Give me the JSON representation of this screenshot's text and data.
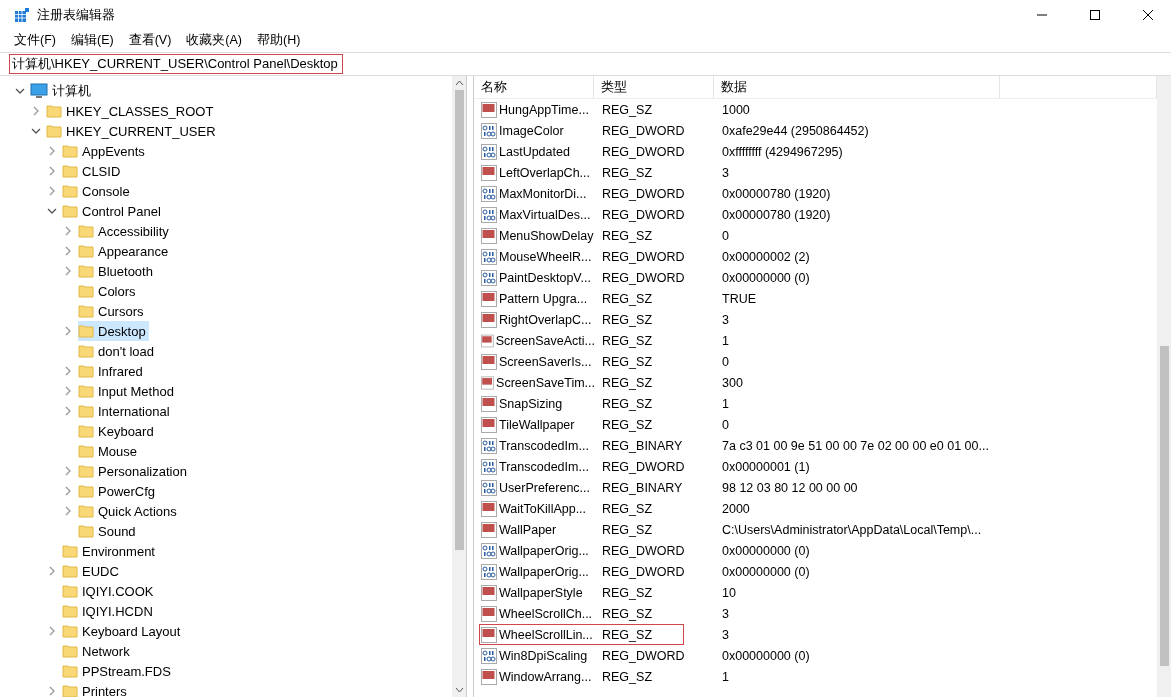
{
  "window": {
    "title": "注册表编辑器"
  },
  "menu": [
    "文件(F)",
    "编辑(E)",
    "查看(V)",
    "收藏夹(A)",
    "帮助(H)"
  ],
  "address": {
    "value": "计算机\\HKEY_CURRENT_USER\\Control Panel\\Desktop",
    "highlighted": true
  },
  "tree": [
    {
      "label": "计算机",
      "kind": "computer",
      "expanded": true,
      "selected": false,
      "children": [
        {
          "label": "HKEY_CLASSES_ROOT",
          "kind": "branch",
          "expanded": false,
          "selected": false
        },
        {
          "label": "HKEY_CURRENT_USER",
          "kind": "branch",
          "expanded": true,
          "selected": false,
          "children": [
            {
              "label": "AppEvents",
              "kind": "branch",
              "expanded": false,
              "selected": false
            },
            {
              "label": "CLSID",
              "kind": "branch",
              "expanded": false,
              "selected": false
            },
            {
              "label": "Console",
              "kind": "branch",
              "expanded": false,
              "selected": false
            },
            {
              "label": "Control Panel",
              "kind": "branch",
              "expanded": true,
              "selected": false,
              "children": [
                {
                  "label": "Accessibility",
                  "kind": "branch",
                  "expanded": false,
                  "selected": false
                },
                {
                  "label": "Appearance",
                  "kind": "branch",
                  "expanded": false,
                  "selected": false
                },
                {
                  "label": "Bluetooth",
                  "kind": "branch",
                  "expanded": false,
                  "selected": false
                },
                {
                  "label": "Colors",
                  "kind": "leaf",
                  "selected": false
                },
                {
                  "label": "Cursors",
                  "kind": "leaf",
                  "selected": false
                },
                {
                  "label": "Desktop",
                  "kind": "branch",
                  "expanded": false,
                  "selected": true
                },
                {
                  "label": "don't load",
                  "kind": "leaf",
                  "selected": false
                },
                {
                  "label": "Infrared",
                  "kind": "branch",
                  "expanded": false,
                  "selected": false
                },
                {
                  "label": "Input Method",
                  "kind": "branch",
                  "expanded": false,
                  "selected": false
                },
                {
                  "label": "International",
                  "kind": "branch",
                  "expanded": false,
                  "selected": false
                },
                {
                  "label": "Keyboard",
                  "kind": "leaf",
                  "selected": false
                },
                {
                  "label": "Mouse",
                  "kind": "leaf",
                  "selected": false
                },
                {
                  "label": "Personalization",
                  "kind": "branch",
                  "expanded": false,
                  "selected": false
                },
                {
                  "label": "PowerCfg",
                  "kind": "branch",
                  "expanded": false,
                  "selected": false
                },
                {
                  "label": "Quick Actions",
                  "kind": "branch",
                  "expanded": false,
                  "selected": false
                },
                {
                  "label": "Sound",
                  "kind": "leaf",
                  "selected": false
                }
              ]
            },
            {
              "label": "Environment",
              "kind": "leaf",
              "selected": false
            },
            {
              "label": "EUDC",
              "kind": "branch",
              "expanded": false,
              "selected": false
            },
            {
              "label": "IQIYI.COOK",
              "kind": "leaf",
              "selected": false
            },
            {
              "label": "IQIYI.HCDN",
              "kind": "leaf",
              "selected": false
            },
            {
              "label": "Keyboard Layout",
              "kind": "branch",
              "expanded": false,
              "selected": false
            },
            {
              "label": "Network",
              "kind": "leaf",
              "selected": false
            },
            {
              "label": "PPStream.FDS",
              "kind": "leaf",
              "selected": false
            },
            {
              "label": "Printers",
              "kind": "branch",
              "expanded": false,
              "selected": false
            }
          ]
        }
      ]
    }
  ],
  "table": {
    "columns": [
      "名称",
      "类型",
      "数据"
    ],
    "rows": [
      {
        "name": "HungAppTime...",
        "type": "REG_SZ",
        "data": "1000",
        "kind": "string",
        "highlighted": false
      },
      {
        "name": "ImageColor",
        "type": "REG_DWORD",
        "data": "0xafe29e44 (2950864452)",
        "kind": "binary",
        "highlighted": false
      },
      {
        "name": "LastUpdated",
        "type": "REG_DWORD",
        "data": "0xffffffff (4294967295)",
        "kind": "binary",
        "highlighted": false
      },
      {
        "name": "LeftOverlapCh...",
        "type": "REG_SZ",
        "data": "3",
        "kind": "string",
        "highlighted": false
      },
      {
        "name": "MaxMonitorDi...",
        "type": "REG_DWORD",
        "data": "0x00000780 (1920)",
        "kind": "binary",
        "highlighted": false
      },
      {
        "name": "MaxVirtualDes...",
        "type": "REG_DWORD",
        "data": "0x00000780 (1920)",
        "kind": "binary",
        "highlighted": false
      },
      {
        "name": "MenuShowDelay",
        "type": "REG_SZ",
        "data": "0",
        "kind": "string",
        "highlighted": false
      },
      {
        "name": "MouseWheelR...",
        "type": "REG_DWORD",
        "data": "0x00000002 (2)",
        "kind": "binary",
        "highlighted": false
      },
      {
        "name": "PaintDesktopV...",
        "type": "REG_DWORD",
        "data": "0x00000000 (0)",
        "kind": "binary",
        "highlighted": false
      },
      {
        "name": "Pattern Upgra...",
        "type": "REG_SZ",
        "data": "TRUE",
        "kind": "string",
        "highlighted": false
      },
      {
        "name": "RightOverlapC...",
        "type": "REG_SZ",
        "data": "3",
        "kind": "string",
        "highlighted": false
      },
      {
        "name": "ScreenSaveActi...",
        "type": "REG_SZ",
        "data": "1",
        "kind": "string",
        "highlighted": false
      },
      {
        "name": "ScreenSaverIs...",
        "type": "REG_SZ",
        "data": "0",
        "kind": "string",
        "highlighted": false
      },
      {
        "name": "ScreenSaveTim...",
        "type": "REG_SZ",
        "data": "300",
        "kind": "string",
        "highlighted": false
      },
      {
        "name": "SnapSizing",
        "type": "REG_SZ",
        "data": "1",
        "kind": "string",
        "highlighted": false
      },
      {
        "name": "TileWallpaper",
        "type": "REG_SZ",
        "data": "0",
        "kind": "string",
        "highlighted": false
      },
      {
        "name": "TranscodedIm...",
        "type": "REG_BINARY",
        "data": "7a c3 01 00 9e 51 00 00 7e 02 00 00 e0 01 00...",
        "kind": "binary",
        "highlighted": false
      },
      {
        "name": "TranscodedIm...",
        "type": "REG_DWORD",
        "data": "0x00000001 (1)",
        "kind": "binary",
        "highlighted": false
      },
      {
        "name": "UserPreferenc...",
        "type": "REG_BINARY",
        "data": "98 12 03 80 12 00 00 00",
        "kind": "binary",
        "highlighted": false
      },
      {
        "name": "WaitToKillApp...",
        "type": "REG_SZ",
        "data": "2000",
        "kind": "string",
        "highlighted": false
      },
      {
        "name": "WallPaper",
        "type": "REG_SZ",
        "data": "C:\\Users\\Administrator\\AppData\\Local\\Temp\\...",
        "kind": "string",
        "highlighted": false
      },
      {
        "name": "WallpaperOrig...",
        "type": "REG_DWORD",
        "data": "0x00000000 (0)",
        "kind": "binary",
        "highlighted": false
      },
      {
        "name": "WallpaperOrig...",
        "type": "REG_DWORD",
        "data": "0x00000000 (0)",
        "kind": "binary",
        "highlighted": false
      },
      {
        "name": "WallpaperStyle",
        "type": "REG_SZ",
        "data": "10",
        "kind": "string",
        "highlighted": false
      },
      {
        "name": "WheelScrollCh...",
        "type": "REG_SZ",
        "data": "3",
        "kind": "string",
        "highlighted": false
      },
      {
        "name": "WheelScrollLin...",
        "type": "REG_SZ",
        "data": "3",
        "kind": "string",
        "highlighted": true
      },
      {
        "name": "Win8DpiScaling",
        "type": "REG_DWORD",
        "data": "0x00000000 (0)",
        "kind": "binary",
        "highlighted": false
      },
      {
        "name": "WindowArrang...",
        "type": "REG_SZ",
        "data": "1",
        "kind": "string",
        "highlighted": false
      }
    ]
  }
}
